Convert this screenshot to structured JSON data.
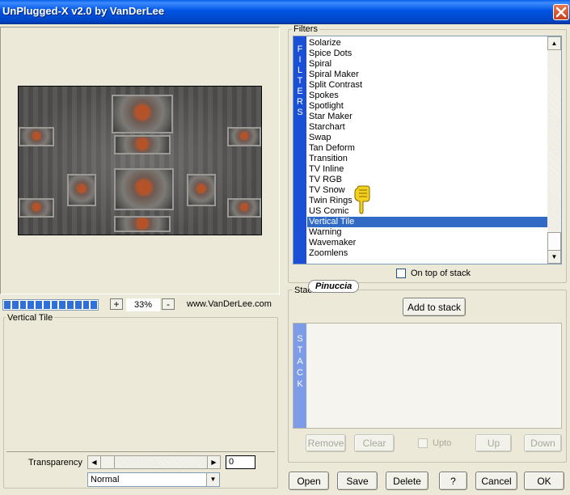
{
  "window": {
    "title": "UnPlugged-X v2.0 by VanDerLee",
    "close_glyph": "✕"
  },
  "zoom": {
    "minus": "-",
    "plus": "+",
    "value": "33%"
  },
  "website": "www.VanDerLee.com",
  "progress": {
    "fraction": 1.0
  },
  "preview": {
    "group_label": "Vertical Tile"
  },
  "filters": {
    "group_label": "Filters",
    "strip_text": "FILTERS",
    "items": [
      "Solarize",
      "Spice Dots",
      "Spiral",
      "Spiral Maker",
      "Split Contrast",
      "Spokes",
      "Spotlight",
      "Star Maker",
      "Starchart",
      "Swap",
      "Tan Deform",
      "Transition",
      "TV Inline",
      "TV RGB",
      "TV Snow",
      "Twin Rings",
      "US Comic",
      "Vertical Tile",
      "Warning",
      "Wavemaker",
      "Zoomlens"
    ],
    "selected": "Vertical Tile",
    "on_top_label": "On top of stack",
    "on_top_checked": false
  },
  "stack": {
    "group_label": "Stack",
    "watermark": "Pinuccia",
    "add_button": "Add to stack",
    "strip_text": "STACK",
    "remove": "Remove",
    "clear": "Clear",
    "upto": "Upto",
    "up": "Up",
    "down": "Down"
  },
  "transparency": {
    "label": "Transparency",
    "value": "0",
    "blend_mode": "Normal"
  },
  "footer": {
    "open": "Open",
    "save": "Save",
    "delete": "Delete",
    "help": "?",
    "cancel": "Cancel",
    "ok": "OK"
  },
  "colors": {
    "titlebar": "#0054e3",
    "selection": "#316ac5",
    "filters_strip": "#1a4fd6",
    "stack_strip": "#7d9be6"
  },
  "icons": {
    "close": "close-icon",
    "pointer": "hand-pointer-icon",
    "scroll_up": "arrow-up-icon",
    "scroll_down": "arrow-down-icon",
    "dropdown": "chevron-down-icon"
  }
}
